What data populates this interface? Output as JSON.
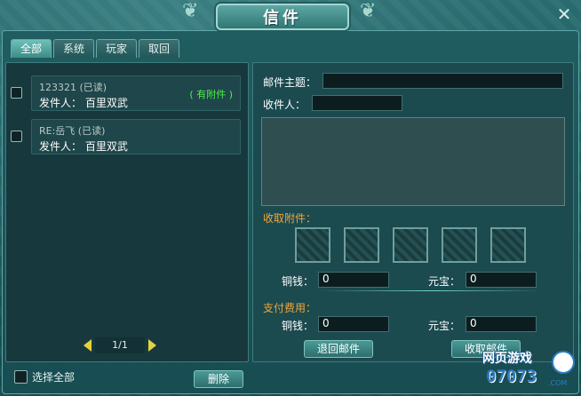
{
  "window": {
    "title": "信件",
    "close_glyph": "✕"
  },
  "tabs": [
    {
      "label": "全部",
      "active": true
    },
    {
      "label": "系统",
      "active": false
    },
    {
      "label": "玩家",
      "active": false
    },
    {
      "label": "取回",
      "active": false
    }
  ],
  "mail_list": [
    {
      "subject": "123321 (已读)",
      "sender": "发件人： 百里双武",
      "attachment": "( 有附件 )"
    },
    {
      "subject": "RE:岳飞 (已读)",
      "sender": "发件人： 百里双武",
      "attachment": ""
    }
  ],
  "pager": {
    "text": "1/1"
  },
  "select_all_label": "选择全部",
  "delete_label": "删除",
  "compose": {
    "subject_label": "邮件主题：",
    "subject_value": "",
    "recipient_label": "收件人：",
    "recipient_value": "",
    "attachments_label": "收取附件：",
    "copper_label": "铜钱：",
    "copper_value": "0",
    "ingot_label": "元宝：",
    "ingot_value": "0",
    "payment_label": "支付费用：",
    "pay_copper_label": "铜钱：",
    "pay_copper_value": "0",
    "pay_ingot_label": "元宝：",
    "pay_ingot_value": "0",
    "return_button": "退回邮件",
    "receive_button": "收取邮件"
  },
  "watermark": {
    "top": "网页游戏",
    "bottom": "07073",
    "suffix": ".COM"
  },
  "colors": {
    "accent": "#4ef04a",
    "orange": "#f0a63a",
    "panel": "#17383d"
  }
}
